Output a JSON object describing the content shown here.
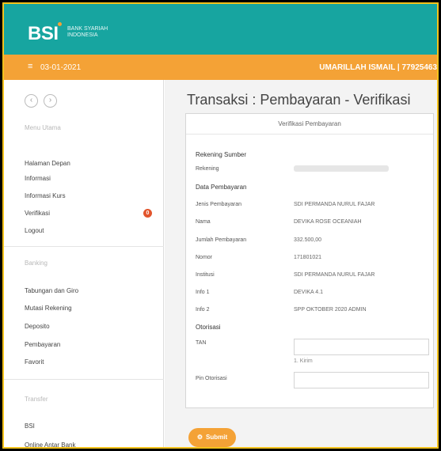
{
  "header": {
    "logo": "BSI",
    "logo_sub": "BANK SYARIAH INDONESIA",
    "date": "03-01-2021",
    "user": "UMARILLAH ISMAIL | 77925463",
    "menu_icon": "hamburger-icon"
  },
  "sidebar": {
    "nav_prev_icon": "chevron-left-icon",
    "nav_next_icon": "chevron-right-icon",
    "section_main": "Menu Utama",
    "main_items": [
      {
        "label": "Halaman Depan"
      },
      {
        "label": "Informasi"
      },
      {
        "label": "Informasi Kurs"
      },
      {
        "label": "Verifikasi",
        "badge": "0"
      },
      {
        "label": "Logout"
      }
    ],
    "section_banking": "Banking",
    "banking_items": [
      {
        "label": "Tabungan dan Giro"
      },
      {
        "label": "Mutasi Rekening"
      },
      {
        "label": "Deposito"
      },
      {
        "label": "Pembayaran"
      },
      {
        "label": "Favorit"
      }
    ],
    "section_transfer": "Transfer",
    "transfer_items": [
      {
        "label": "BSI"
      },
      {
        "label": "Online Antar Bank"
      }
    ]
  },
  "main": {
    "title": "Transaksi : Pembayaran - Verifikasi",
    "panel_title": "Verifikasi Pembayaran",
    "rekening_sumber_title": "Rekening Sumber",
    "rekening_label": "Rekening",
    "data_pembayaran_title": "Data Pembayaran",
    "fields": [
      {
        "label": "Jenis Pembayaran",
        "value": "SDI PERMANDA NURUL FAJAR"
      },
      {
        "label": "Nama",
        "value": "DEVIKA ROSE OCEANIAH"
      },
      {
        "label": "Jumlah Pembayaran",
        "value": "332.500,00"
      },
      {
        "label": "Nomor",
        "value": "171801021"
      },
      {
        "label": "Institusi",
        "value": "SDI PERMANDA NURUL FAJAR"
      },
      {
        "label": "Info 1",
        "value": "DEVIKA 4.1"
      },
      {
        "label": "Info 2",
        "value": "SPP OKTOBER 2020 ADMIN"
      }
    ],
    "otorisasi_title": "Otorisasi",
    "tab_label": "TAN",
    "tab_hint": "1. Kirim",
    "pin_label": "Pin Otorisasi",
    "submit_label": "Submit"
  }
}
